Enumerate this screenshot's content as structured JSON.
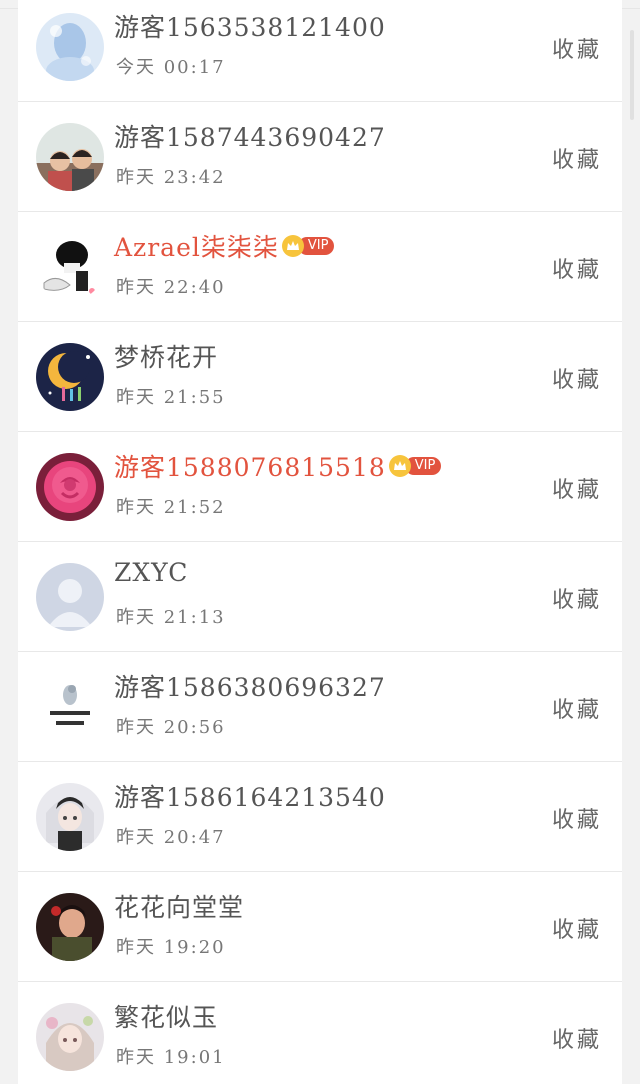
{
  "users": [
    {
      "name": "游客1563538121400",
      "time": "今天 00:17",
      "action": "收藏",
      "vip": false,
      "avatar_icon": "blue-illustration-avatar-icon"
    },
    {
      "name": "游客1587443690427",
      "time": "昨天 23:42",
      "action": "收藏",
      "vip": false,
      "avatar_icon": "two-people-photo-avatar-icon"
    },
    {
      "name": "Azrael柒柒柒",
      "time": "昨天 22:40",
      "action": "收藏",
      "vip": true,
      "vip_label": "VIP",
      "avatar_icon": "cartoon-black-hair-avatar-icon"
    },
    {
      "name": "梦桥花开",
      "time": "昨天 21:55",
      "action": "收藏",
      "vip": false,
      "avatar_icon": "crescent-moon-avatar-icon"
    },
    {
      "name": "游客1588076815518",
      "time": "昨天 21:52",
      "action": "收藏",
      "vip": true,
      "vip_label": "VIP",
      "avatar_icon": "pink-rose-avatar-icon"
    },
    {
      "name": "ZXYC",
      "time": "昨天 21:13",
      "action": "收藏",
      "vip": false,
      "avatar_icon": "default-person-avatar-icon"
    },
    {
      "name": "游客1586380696327",
      "time": "昨天 20:56",
      "action": "收藏",
      "vip": false,
      "avatar_icon": "text-meme-avatar-icon"
    },
    {
      "name": "游客1586164213540",
      "time": "昨天 20:47",
      "action": "收藏",
      "vip": false,
      "avatar_icon": "anime-character-avatar-icon"
    },
    {
      "name": "花花向堂堂",
      "time": "昨天 19:20",
      "action": "收藏",
      "vip": false,
      "avatar_icon": "portrait-photo-avatar-icon"
    },
    {
      "name": "繁花似玉",
      "time": "昨天 19:01",
      "action": "收藏",
      "vip": false,
      "avatar_icon": "anime-girl-avatar-icon"
    }
  ],
  "colors": {
    "vip_red": "#e2533e",
    "accent_orange": "#f5a623",
    "text_gray": "#555555"
  }
}
